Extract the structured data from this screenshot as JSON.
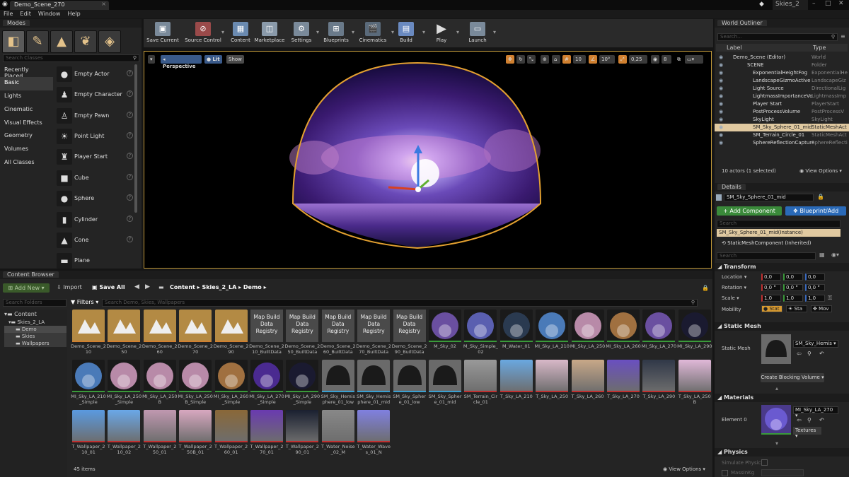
{
  "titlebar": {
    "document_tab": "Demo_Scene_270",
    "close_glyph": "×",
    "project": "Skies_2",
    "min_glyph": "–",
    "max_glyph": "□",
    "close_win_glyph": "✕"
  },
  "menu": [
    "File",
    "Edit",
    "Window",
    "Help"
  ],
  "modes": {
    "tab": "Modes",
    "search_placeholder": "Search Classes",
    "categories": [
      "Recently Placed",
      "Basic",
      "Lights",
      "Cinematic",
      "Visual Effects",
      "Geometry",
      "Volumes",
      "All Classes"
    ],
    "selected_category": "Basic",
    "items": [
      {
        "label": "Empty Actor",
        "icon": "sphere-icon"
      },
      {
        "label": "Empty Character",
        "icon": "character-icon"
      },
      {
        "label": "Empty Pawn",
        "icon": "pawn-icon"
      },
      {
        "label": "Point Light",
        "icon": "bulb-icon"
      },
      {
        "label": "Player Start",
        "icon": "player-icon"
      },
      {
        "label": "Cube",
        "icon": "cube-icon"
      },
      {
        "label": "Sphere",
        "icon": "sphere-icon"
      },
      {
        "label": "Cylinder",
        "icon": "cylinder-icon"
      },
      {
        "label": "Cone",
        "icon": "cone-icon"
      },
      {
        "label": "Plane",
        "icon": "plane-icon"
      }
    ]
  },
  "toolbar": [
    {
      "label": "Save Current",
      "icon": "save-icon"
    },
    {
      "label": "Source Control",
      "icon": "source-control-icon"
    },
    {
      "label": "Content",
      "icon": "content-icon"
    },
    {
      "label": "Marketplace",
      "icon": "marketplace-icon"
    },
    {
      "label": "Settings",
      "icon": "settings-icon"
    },
    {
      "label": "Blueprints",
      "icon": "blueprints-icon"
    },
    {
      "label": "Cinematics",
      "icon": "cinematics-icon"
    },
    {
      "label": "Build",
      "icon": "build-icon"
    },
    {
      "label": "Play",
      "icon": "play-icon"
    },
    {
      "label": "Launch",
      "icon": "launch-icon"
    }
  ],
  "viewport": {
    "perspective": "Perspective",
    "lit": "Lit",
    "show": "Show",
    "grid_snap": "10",
    "rot_snap": "10°",
    "scale_snap": "0,25",
    "cam_speed": "8"
  },
  "outliner": {
    "tab": "World Outliner",
    "search_placeholder": "Search...",
    "col_label": "Label",
    "col_type": "Type",
    "rows": [
      {
        "label": "Demo_Scene (Editor)",
        "type": "World"
      },
      {
        "label": "SCENE",
        "type": "Folder"
      },
      {
        "label": "ExponentialHeightFog",
        "type": "ExponentialHe"
      },
      {
        "label": "LandscapeGizmoActive",
        "type": "LandscapeGiz"
      },
      {
        "label": "Light Source",
        "type": "DirectionalLig"
      },
      {
        "label": "LightmassImportanceVo",
        "type": "LightmassImp"
      },
      {
        "label": "Player Start",
        "type": "PlayerStart"
      },
      {
        "label": "PostProcessVolume",
        "type": "PostProcessV"
      },
      {
        "label": "SkyLight",
        "type": "SkyLight"
      },
      {
        "label": "SM_Sky_Sphere_01_mid",
        "type": "StaticMeshAct"
      },
      {
        "label": "SM_Terrain_Circle_01",
        "type": "StaticMeshAct"
      },
      {
        "label": "SphereReflectionCapture",
        "type": "SphereReflecti"
      }
    ],
    "footer": "10 actors (1 selected)",
    "view_options": "View Options"
  },
  "details": {
    "tab": "Details",
    "name": "SM_Sky_Sphere_01_mid",
    "add_component": "+ Add Component",
    "blueprint_add": "Blueprint/Add",
    "search_placeholder": "Search",
    "instance": "SM_Sky_Sphere_01_mid(Instance)",
    "component": "StaticMeshComponent (Inherited)",
    "transform": "Transform",
    "location": "Location",
    "rotation": "Rotation",
    "scale": "Scale",
    "mobility": "Mobility",
    "loc": [
      "0,0",
      "0,0",
      "0,0"
    ],
    "rot": [
      "0,0 °",
      "0,0 °",
      "0,0 °"
    ],
    "scl": [
      "1,0",
      "1,0",
      "1,0"
    ],
    "mob": [
      "Stat",
      "Sta",
      "Mov"
    ],
    "static_mesh_section": "Static Mesh",
    "static_mesh_label": "Static Mesh",
    "static_mesh_value": "SM_Sky_Hemis",
    "create_blocking": "Create Blocking Volume",
    "materials_section": "Materials",
    "element0": "Element 0",
    "material_value": "MI_Sky_LA_270",
    "textures": "Textures",
    "physics_section": "Physics",
    "simulate_physics": "Simulate Physic",
    "mass_kg": "MassInKg"
  },
  "content_browser": {
    "tab": "Content Browser",
    "add_new": "Add New",
    "import": "Import",
    "save_all": "Save All",
    "breadcrumb": [
      "Content",
      "Skies_2_LA",
      "Demo"
    ],
    "search_folders": "Search Folders",
    "filters": "Filters",
    "search_assets": "Search Demo, Skies, Wallpapers",
    "tree": [
      "Content",
      "Skies_2_LA",
      "Demo",
      "Skies",
      "Wallpapers"
    ],
    "count": "45 items",
    "view_options": "View Options",
    "assets": [
      {
        "name": "Demo_Scene_210",
        "color": "#b38a44"
      },
      {
        "name": "Demo_Scene_250",
        "color": "#b38a44"
      },
      {
        "name": "Demo_Scene_260",
        "color": "#b38a44"
      },
      {
        "name": "Demo_Scene_270",
        "color": "#b38a44"
      },
      {
        "name": "Demo_Scene_290",
        "color": "#b38a44"
      },
      {
        "name": "Demo_Scene_210_BuiltData",
        "mbdr": "Map Build Data Registry"
      },
      {
        "name": "Demo_Scene_250_BuiltData",
        "mbdr": "Map Build Data Registry"
      },
      {
        "name": "Demo_Scene_260_BuiltData",
        "mbdr": "Map Build Data Registry"
      },
      {
        "name": "Demo_Scene_270_BuiltData",
        "mbdr": "Map Build Data Registry"
      },
      {
        "name": "Demo_Scene_290_BuiltData",
        "mbdr": "Map Build Data Registry"
      },
      {
        "name": "M_Sky_02",
        "color": "#6a4fa0"
      },
      {
        "name": "M_Sky_Simple_02",
        "color": "#5a5fb0"
      },
      {
        "name": "M_Water_01",
        "color": "#2a3a50"
      },
      {
        "name": "MI_Sky_LA_210",
        "color": "#4a7ab8"
      },
      {
        "name": "MI_Sky_LA_250",
        "color": "#b88aa8"
      },
      {
        "name": "MI_Sky_LA_260",
        "color": "#a07040"
      },
      {
        "name": "MI_Sky_LA_270",
        "color": "#6a4fa0"
      },
      {
        "name": "MI_Sky_LA_290",
        "color": "#1a1a30"
      },
      {
        "name": "MI_Sky_LA_210_Simple",
        "color": "#4a7ab8"
      },
      {
        "name": "MI_Sky_LA_250_Simple",
        "color": "#b88aa8"
      },
      {
        "name": "MI_Sky_LA_250B",
        "color": "#b88aa8"
      },
      {
        "name": "MI_Sky_LA_250B_Simple",
        "color": "#b88aa8"
      },
      {
        "name": "MI_Sky_LA_260_Simple",
        "color": "#a07040"
      },
      {
        "name": "MI_Sky_LA_270_Simple",
        "color": "#4a2a90"
      },
      {
        "name": "MI_Sky_LA_290_Simple",
        "color": "#1a1a30"
      },
      {
        "name": "SM_Sky_Hemisphere_01_low",
        "color": "#555"
      },
      {
        "name": "SM_Sky_Hemisphere_01_mid",
        "color": "#555"
      },
      {
        "name": "SM_Sky_Sphere_01_low",
        "color": "#555"
      },
      {
        "name": "SM_Sky_Sphere_01_mid",
        "color": "#555"
      },
      {
        "name": "SM_Terrain_Circle_01",
        "color": "#999"
      },
      {
        "name": "T_Sky_LA_210",
        "color": "#6aa8e0"
      },
      {
        "name": "T_Sky_LA_250",
        "color": "#d8b8c8"
      },
      {
        "name": "T_Sky_LA_260",
        "color": "#c8a888"
      },
      {
        "name": "T_Sky_LA_270",
        "color": "#6a4fc0"
      },
      {
        "name": "T_Sky_LA_290",
        "color": "#303848"
      },
      {
        "name": "T_Sky_LA_250B",
        "color": "#e0b8d8"
      },
      {
        "name": "T_Wallpaper_210_01",
        "color": "#5a9ae0"
      },
      {
        "name": "T_Wallpaper_210_02",
        "color": "#6aa8e8"
      },
      {
        "name": "T_Wallpaper_250_01",
        "color": "#c098b0"
      },
      {
        "name": "T_Wallpaper_250B_01",
        "color": "#d8a8c0"
      },
      {
        "name": "T_Wallpaper_260_01",
        "color": "#8a6838"
      },
      {
        "name": "T_Wallpaper_270_01",
        "color": "#6a3ab0"
      },
      {
        "name": "T_Wallpaper_290_01",
        "color": "#1a2030"
      },
      {
        "name": "T_Water_Noise_02_M",
        "color": "#888"
      },
      {
        "name": "T_Water_Waves_01_N",
        "color": "#8080e0"
      }
    ]
  }
}
